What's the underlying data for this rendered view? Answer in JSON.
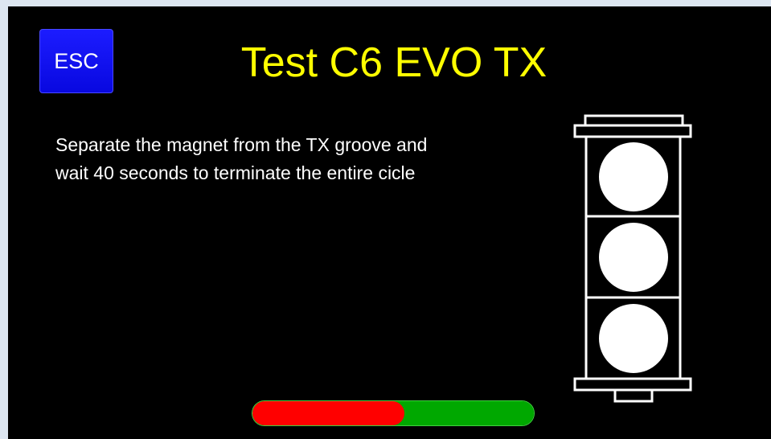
{
  "header": {
    "esc_label": "ESC",
    "title": "Test C6 EVO TX"
  },
  "instructions": {
    "line1": "Separate the magnet from the TX groove and",
    "line2": "wait 40 seconds to terminate the entire cicle"
  },
  "traffic_light": {
    "lamps": [
      "off",
      "off",
      "off"
    ],
    "lamp_color": "#ffffff",
    "frame_color": "#ffffff"
  },
  "progress": {
    "fraction": 0.54,
    "fill_color": "#ff0000",
    "track_color": "#00a800"
  },
  "colors": {
    "background": "#000000",
    "title": "#ffff00",
    "button": "#1010f0"
  }
}
